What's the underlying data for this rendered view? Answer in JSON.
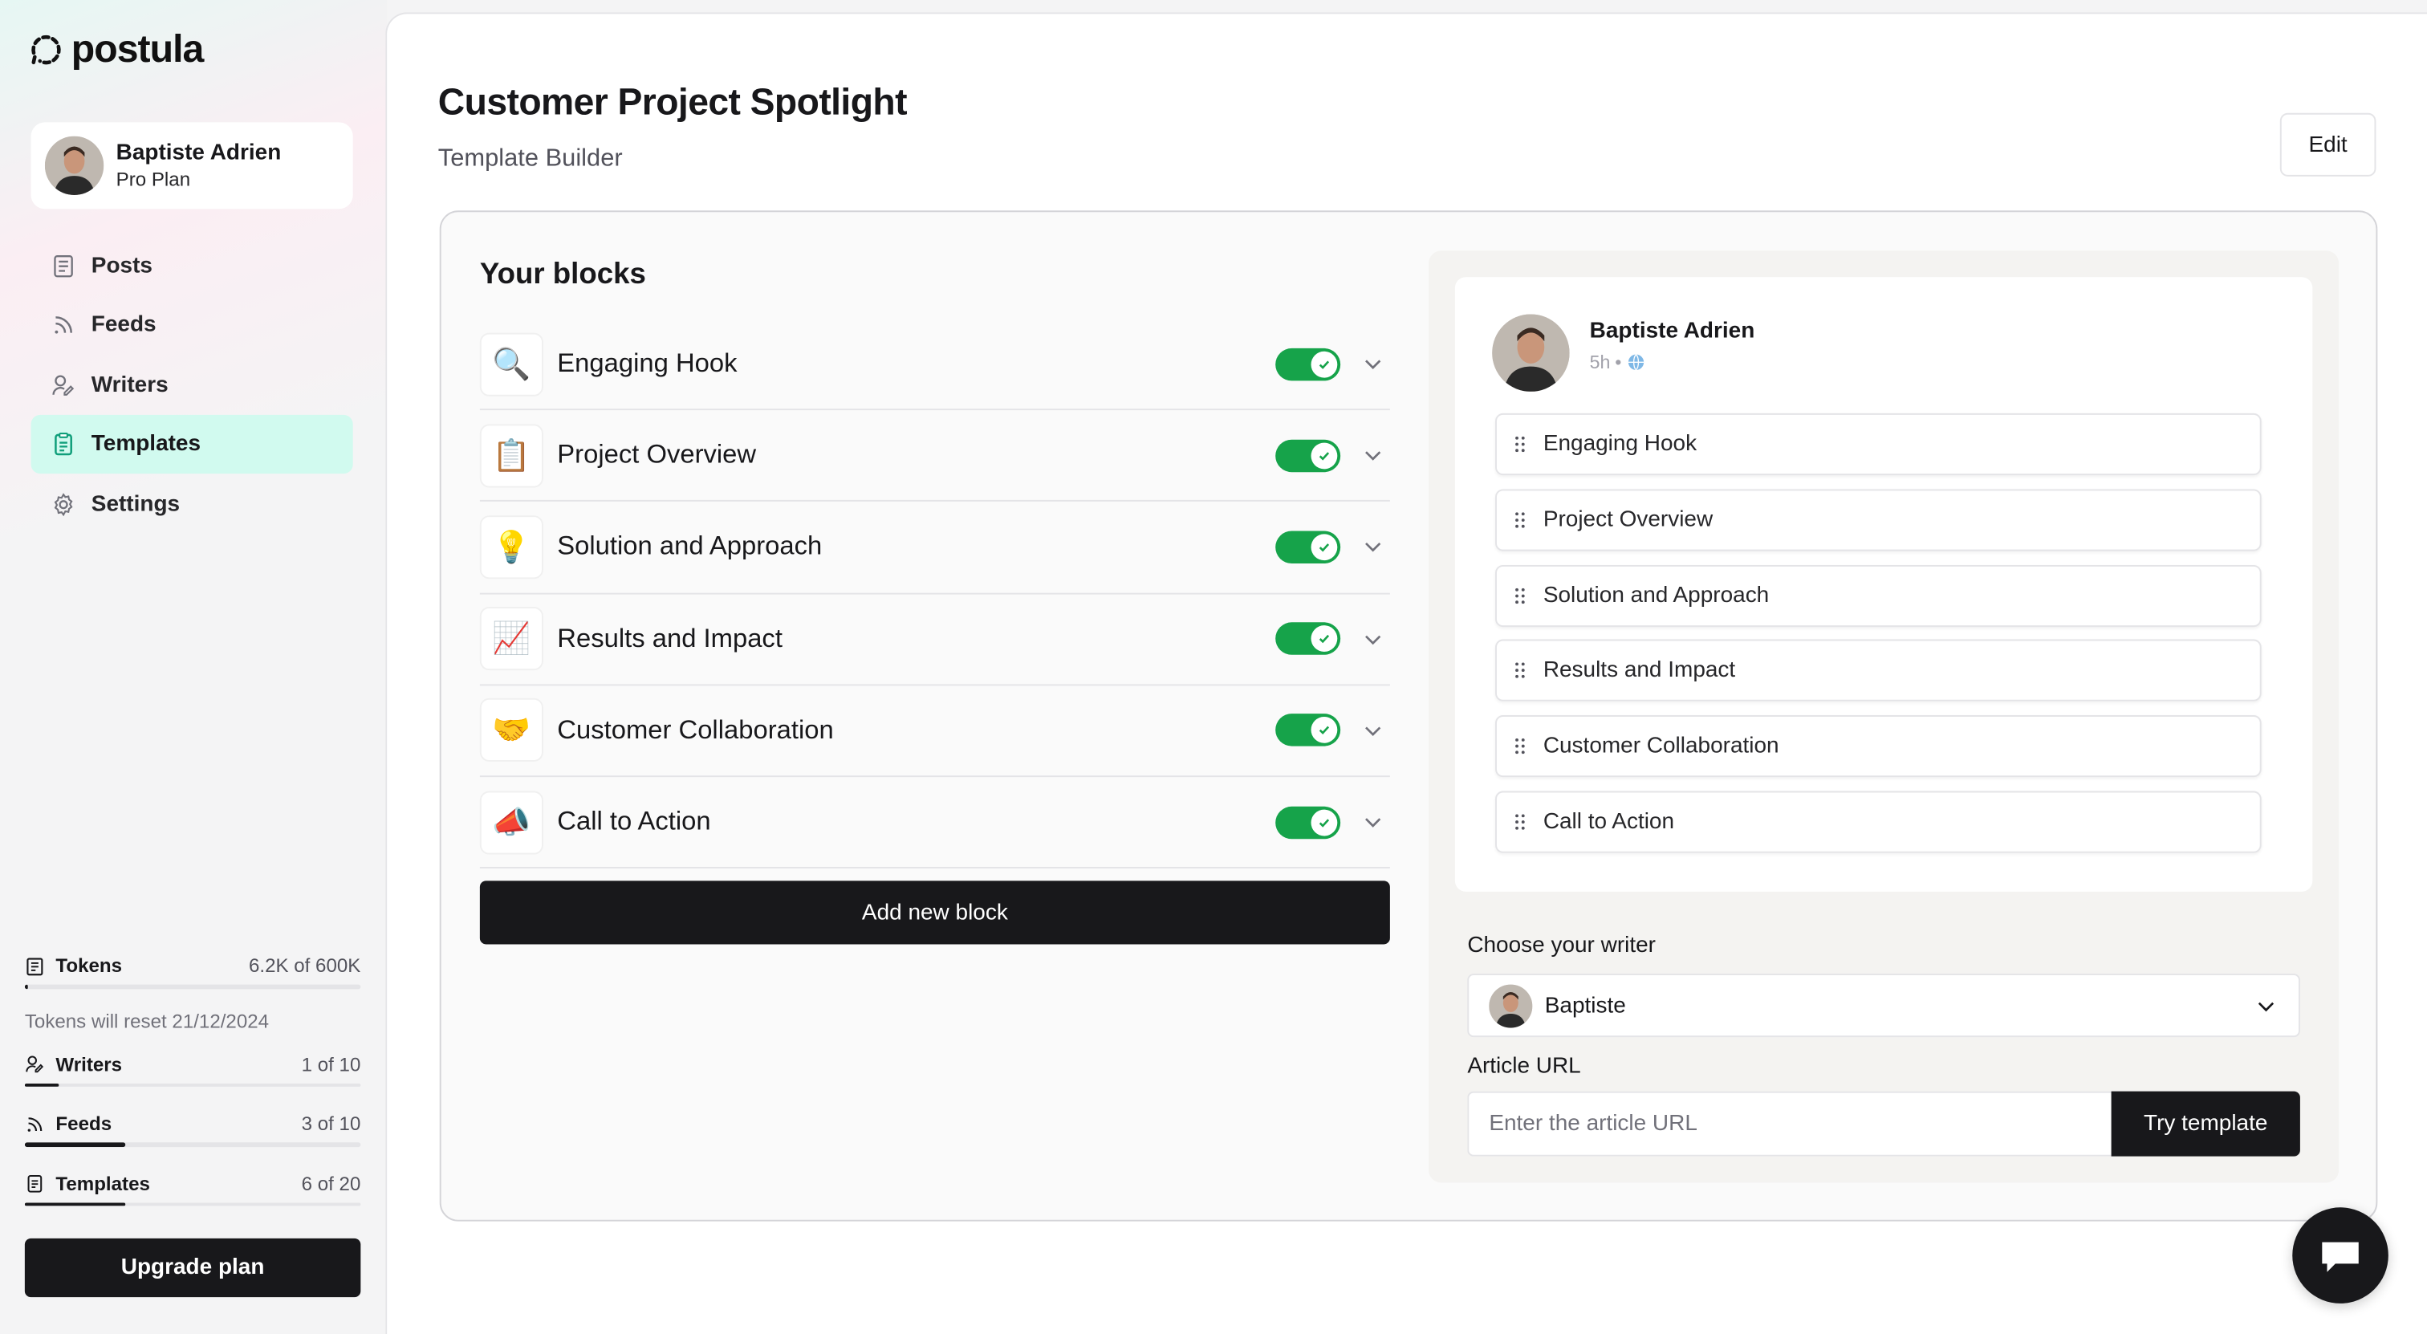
{
  "app": {
    "name": "postula"
  },
  "user": {
    "name": "Baptiste Adrien",
    "plan": "Pro Plan"
  },
  "nav": {
    "items": [
      {
        "label": "Posts",
        "icon": "posts-icon",
        "active": false
      },
      {
        "label": "Feeds",
        "icon": "rss-icon",
        "active": false
      },
      {
        "label": "Writers",
        "icon": "writers-icon",
        "active": false
      },
      {
        "label": "Templates",
        "icon": "templates-icon",
        "active": true
      },
      {
        "label": "Settings",
        "icon": "gear-icon",
        "active": false
      }
    ]
  },
  "usage": {
    "tokens": {
      "label": "Tokens",
      "value": "6.2K of 600K",
      "fraction": 0.0103
    },
    "reset_note": "Tokens will reset 21/12/2024",
    "writers": {
      "label": "Writers",
      "value": "1 of 10",
      "fraction": 0.1
    },
    "feeds": {
      "label": "Feeds",
      "value": "3 of 10",
      "fraction": 0.3
    },
    "templates": {
      "label": "Templates",
      "value": "6 of 20",
      "fraction": 0.3
    }
  },
  "upgrade_label": "Upgrade plan",
  "page": {
    "title": "Customer Project Spotlight",
    "subtitle": "Template Builder",
    "edit_label": "Edit"
  },
  "blocks": {
    "title": "Your blocks",
    "items": [
      {
        "emoji": "🔍",
        "label": "Engaging Hook",
        "enabled": true
      },
      {
        "emoji": "📋",
        "label": "Project Overview",
        "enabled": true
      },
      {
        "emoji": "💡",
        "label": "Solution and Approach",
        "enabled": true
      },
      {
        "emoji": "📈",
        "label": "Results and Impact",
        "enabled": true
      },
      {
        "emoji": "🤝",
        "label": "Customer Collaboration",
        "enabled": true
      },
      {
        "emoji": "📣",
        "label": "Call to Action",
        "enabled": true
      }
    ],
    "add_label": "Add new block"
  },
  "preview": {
    "author": "Baptiste Adrien",
    "time": "5h",
    "separator": "•",
    "blocks": [
      "Engaging Hook",
      "Project Overview",
      "Solution and Approach",
      "Results and Impact",
      "Customer Collaboration",
      "Call to Action"
    ]
  },
  "writer": {
    "label": "Choose your writer",
    "selected": "Baptiste"
  },
  "article": {
    "label": "Article URL",
    "placeholder": "Enter the article URL",
    "button": "Try template"
  },
  "colors": {
    "accent_active": "#d1faef",
    "toggle_on": "#16a34a",
    "primary": "#18181b"
  }
}
